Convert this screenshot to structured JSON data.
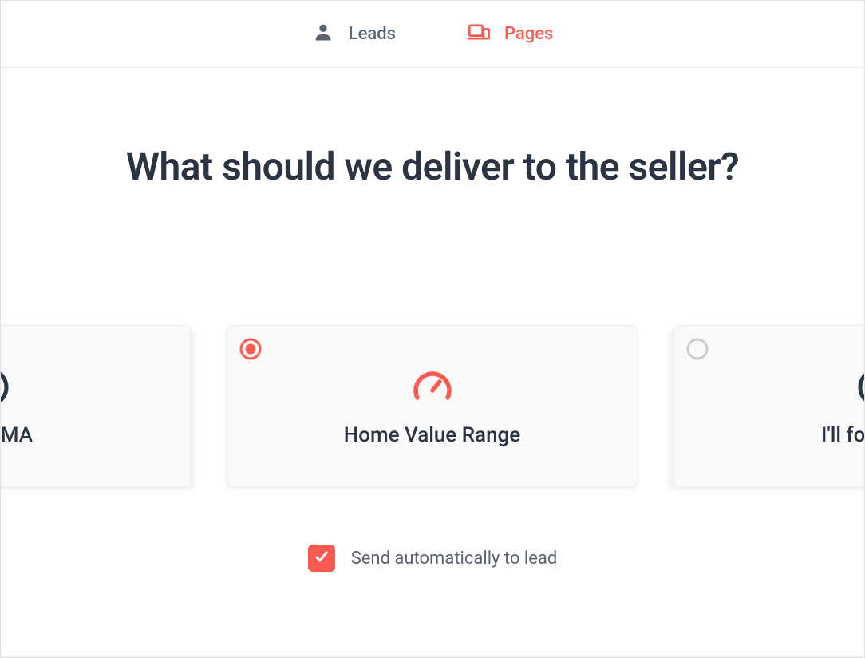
{
  "colors": {
    "accent": "#fa5a50",
    "text_primary": "#2b3442",
    "text_muted": "#5a6472",
    "icon_muted": "#5a6472",
    "radio_unselected_stroke": "#c8cdd2"
  },
  "nav": {
    "items": [
      {
        "label": "Leads",
        "active": false
      },
      {
        "label": "Pages",
        "active": true
      }
    ]
  },
  "page": {
    "title": "What should we deliver to the seller?"
  },
  "cards": [
    {
      "label": "CMA",
      "selected": false
    },
    {
      "label": "Home Value Range",
      "selected": true
    },
    {
      "label": "I'll fo",
      "selected": false
    }
  ],
  "checkbox": {
    "label": "Send automatically to lead",
    "checked": true
  }
}
